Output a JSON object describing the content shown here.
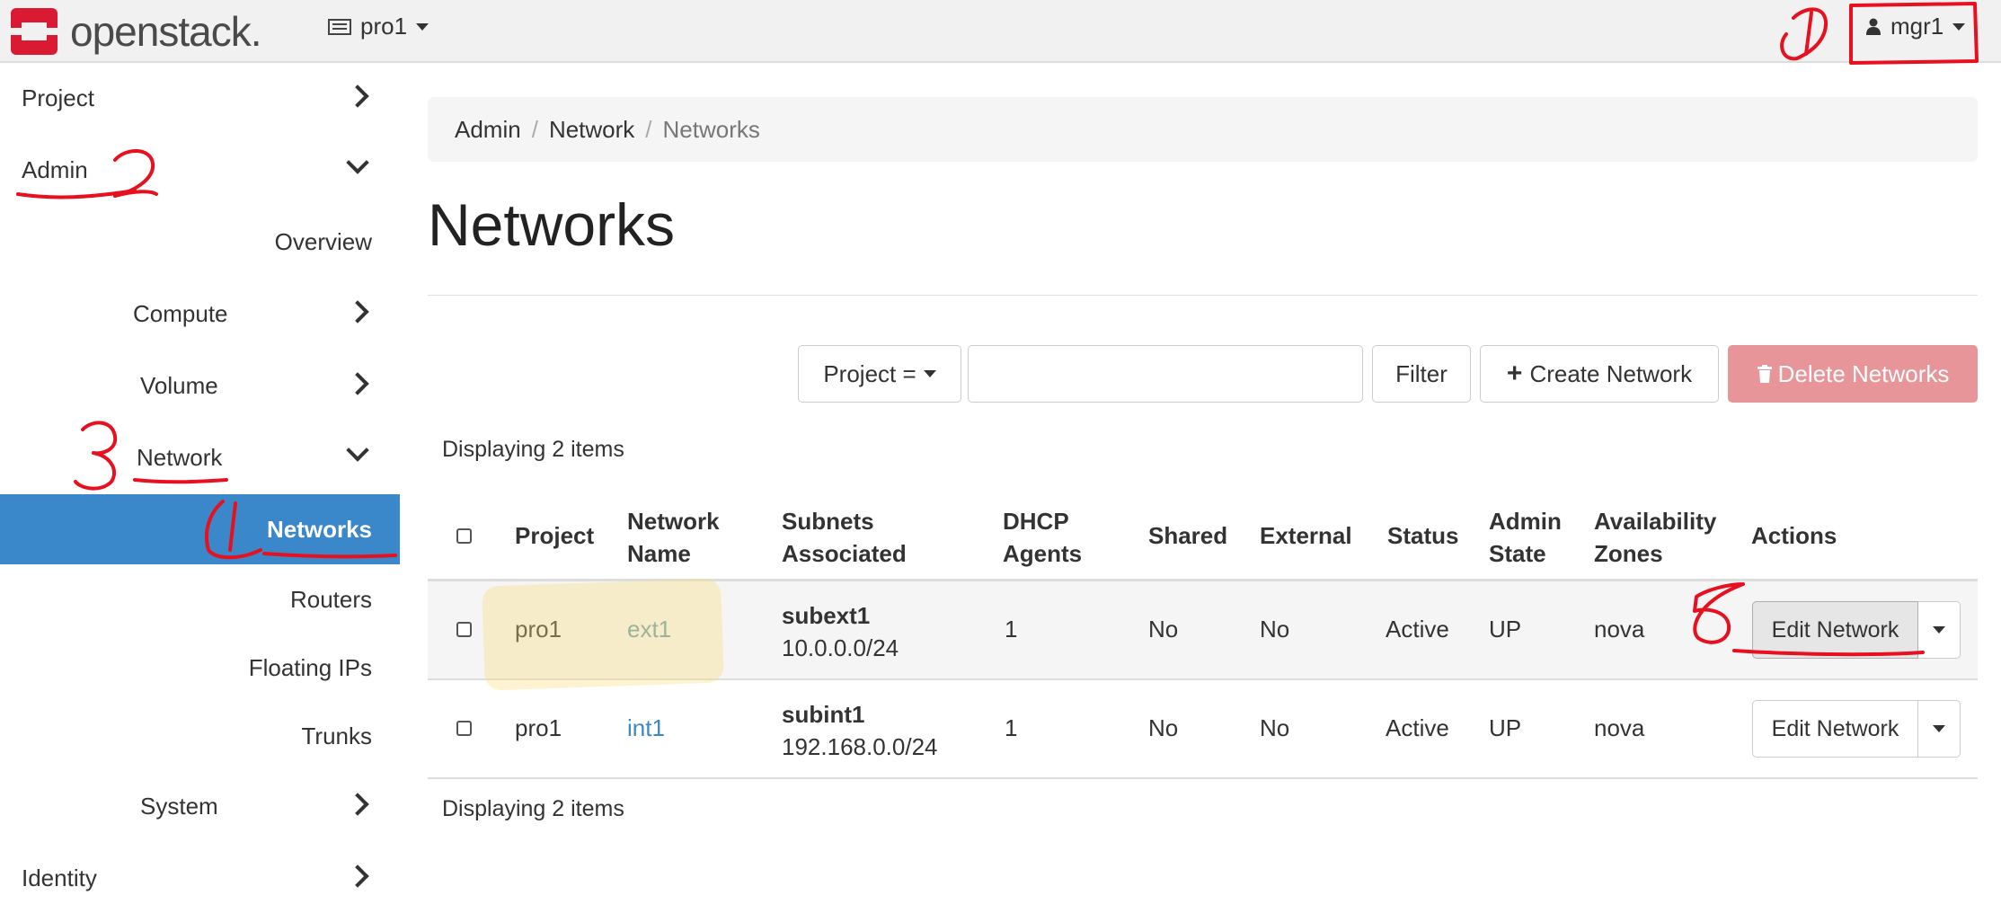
{
  "topbar": {
    "brand": "openstack.",
    "project_switcher": "pro1",
    "user": "mgr1"
  },
  "sidebar": {
    "items": [
      {
        "label": "Project"
      },
      {
        "label": "Admin"
      },
      {
        "label": "Overview"
      },
      {
        "label": "Compute"
      },
      {
        "label": "Volume"
      },
      {
        "label": "Network"
      },
      {
        "label": "Networks"
      },
      {
        "label": "Routers"
      },
      {
        "label": "Floating IPs"
      },
      {
        "label": "Trunks"
      },
      {
        "label": "System"
      },
      {
        "label": "Identity"
      }
    ]
  },
  "breadcrumb": [
    "Admin",
    "Network",
    "Networks"
  ],
  "page": {
    "title": "Networks"
  },
  "toolbar": {
    "filter_field": "Project =",
    "filter_value": "",
    "filter_button": "Filter",
    "create_button": "Create Network",
    "delete_button": "Delete Networks"
  },
  "table": {
    "count_top": "Displaying 2 items",
    "count_bottom": "Displaying 2 items",
    "headers": {
      "project": "Project",
      "network_name_1": "Network",
      "network_name_2": "Name",
      "subnets_1": "Subnets",
      "subnets_2": "Associated",
      "dhcp_1": "DHCP",
      "dhcp_2": "Agents",
      "shared": "Shared",
      "external": "External",
      "status": "Status",
      "admin_1": "Admin",
      "admin_2": "State",
      "az_1": "Availability",
      "az_2": "Zones",
      "actions": "Actions"
    },
    "rows": [
      {
        "project": "pro1",
        "name": "ext1",
        "subnet_name": "subext1",
        "subnet_cidr": "10.0.0.0/24",
        "dhcp": "1",
        "shared": "No",
        "external": "No",
        "status": "Active",
        "admin_state": "UP",
        "az": "nova",
        "action": "Edit Network"
      },
      {
        "project": "pro1",
        "name": "int1",
        "subnet_name": "subint1",
        "subnet_cidr": "192.168.0.0/24",
        "dhcp": "1",
        "shared": "No",
        "external": "No",
        "status": "Active",
        "admin_state": "UP",
        "az": "nova",
        "action": "Edit Network"
      }
    ]
  },
  "colors": {
    "accent": "#3a87c9",
    "danger": "#e8959a",
    "brand": "#da1a32",
    "annotation": "#e8101e"
  },
  "icons": [
    "server-icon",
    "user-icon",
    "plus-icon",
    "trash-icon",
    "chevron-right-icon",
    "chevron-down-icon",
    "caret-down-icon"
  ],
  "annotations": [
    "1",
    "2",
    "3",
    "4",
    "5"
  ]
}
